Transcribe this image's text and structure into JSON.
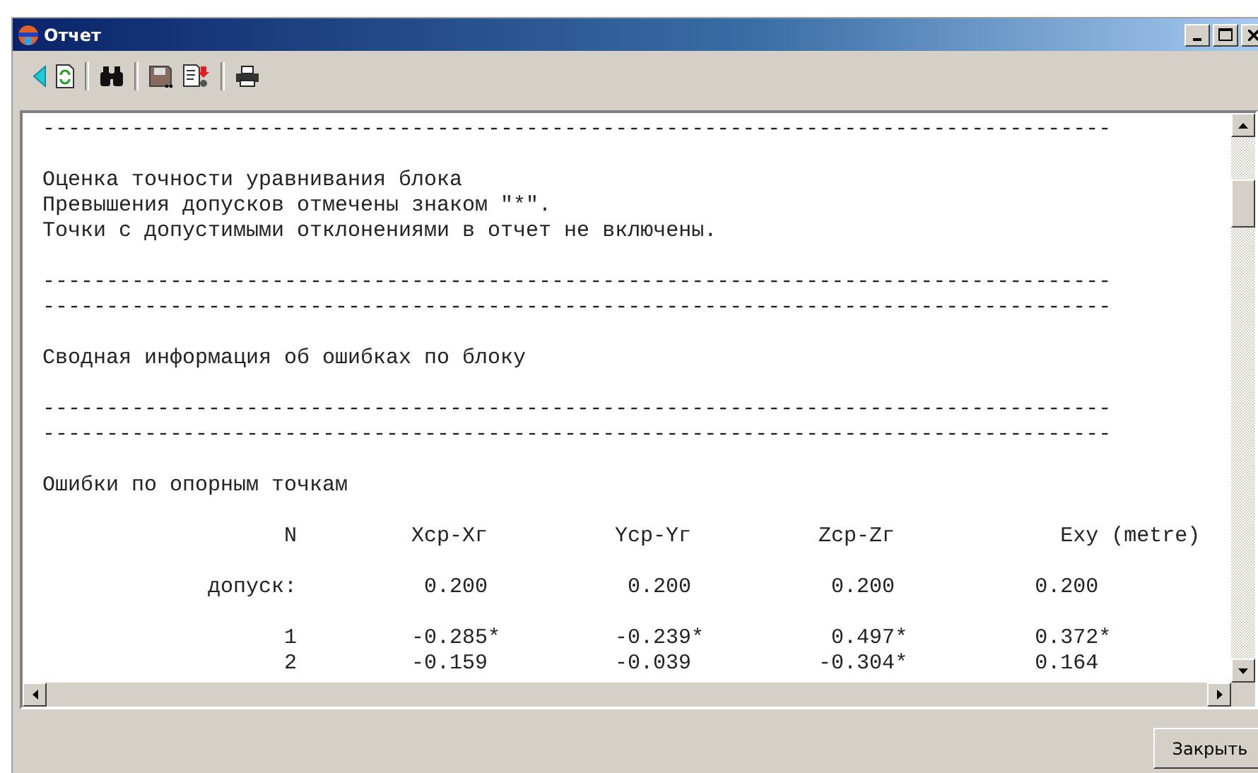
{
  "window": {
    "title": "Отчет"
  },
  "report": {
    "lines": [
      {
        "kind": "rule",
        "text": "------------------------------------------------------------------------------------"
      },
      {
        "kind": "blank"
      },
      {
        "kind": "text",
        "text": "Оценка точности уравнивания блока"
      },
      {
        "kind": "text",
        "text": "Превышения допусков отмечены знаком \"*\"."
      },
      {
        "kind": "text",
        "text": "Точки с допустимыми отклонениями в отчет не включены."
      },
      {
        "kind": "blank"
      },
      {
        "kind": "rule",
        "text": "------------------------------------------------------------------------------------"
      },
      {
        "kind": "rule",
        "text": "------------------------------------------------------------------------------------"
      },
      {
        "kind": "blank"
      },
      {
        "kind": "text",
        "text": "Сводная информация об ошибках по блоку"
      },
      {
        "kind": "blank"
      },
      {
        "kind": "rule",
        "text": "------------------------------------------------------------------------------------"
      },
      {
        "kind": "rule",
        "text": "------------------------------------------------------------------------------------"
      },
      {
        "kind": "blank"
      },
      {
        "kind": "text",
        "text": "Ошибки по опорным точкам"
      },
      {
        "kind": "blank"
      },
      {
        "kind": "row",
        "cells": [
          {
            "text": "N"
          },
          {
            "text": "Xср-Xг"
          },
          {
            "text": "Yср-Yг"
          },
          {
            "text": "Zср-Zг"
          },
          {
            "text": "Exy"
          }
        ],
        "unit": "(metre)"
      },
      {
        "kind": "blank"
      },
      {
        "kind": "row",
        "cells": [
          {
            "text": "допуск:"
          },
          {
            "text": "0.200"
          },
          {
            "text": "0.200"
          },
          {
            "text": "0.200"
          },
          {
            "text": "0.200"
          }
        ]
      },
      {
        "kind": "blank"
      },
      {
        "kind": "row",
        "cells": [
          {
            "text": "1"
          },
          {
            "text": "-0.285",
            "mark": "*"
          },
          {
            "text": "-0.239",
            "mark": "*"
          },
          {
            "text": "0.497",
            "mark": "*"
          },
          {
            "text": "0.372",
            "mark": "*"
          }
        ]
      },
      {
        "kind": "row",
        "cells": [
          {
            "text": "2"
          },
          {
            "text": "-0.159"
          },
          {
            "text": "-0.039"
          },
          {
            "text": "-0.304",
            "mark": "*"
          },
          {
            "text": "0.164"
          }
        ]
      }
    ]
  },
  "buttons": [
    {
      "label": "Закрыть"
    }
  ]
}
